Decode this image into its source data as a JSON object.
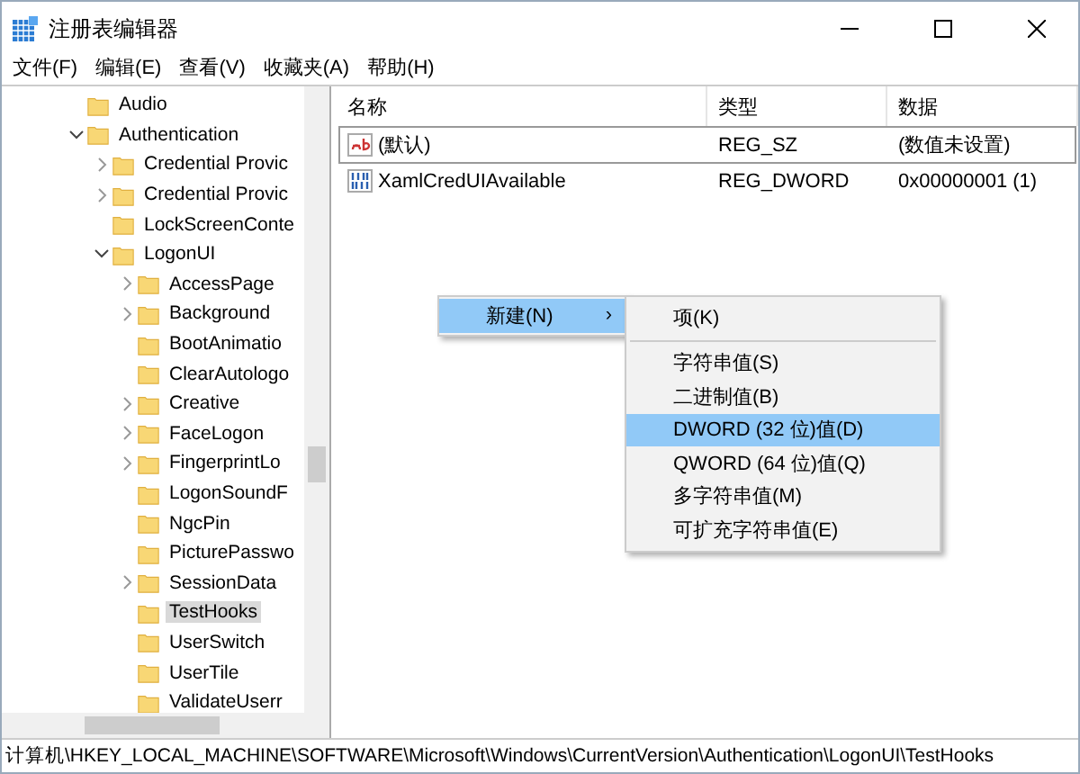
{
  "window": {
    "title": "注册表编辑器"
  },
  "menu": [
    "文件(F)",
    "编辑(E)",
    "查看(V)",
    "收藏夹(A)",
    "帮助(H)"
  ],
  "tree": [
    {
      "label": "Audio",
      "kind": "leaf",
      "selected": false
    },
    {
      "label": "Authentication",
      "kind": "open",
      "selected": false,
      "children": [
        {
          "label": "Credential Provic",
          "kind": "closed",
          "selected": false
        },
        {
          "label": "Credential Provic",
          "kind": "closed",
          "selected": false
        },
        {
          "label": "LockScreenConte",
          "kind": "leaf",
          "selected": false
        },
        {
          "label": "LogonUI",
          "kind": "open",
          "selected": false,
          "children": [
            {
              "label": "AccessPage",
              "kind": "closed",
              "selected": false
            },
            {
              "label": "Background",
              "kind": "closed",
              "selected": false
            },
            {
              "label": "BootAnimatio",
              "kind": "leaf",
              "selected": false
            },
            {
              "label": "ClearAutologo",
              "kind": "leaf",
              "selected": false
            },
            {
              "label": "Creative",
              "kind": "closed",
              "selected": false
            },
            {
              "label": "FaceLogon",
              "kind": "closed",
              "selected": false
            },
            {
              "label": "FingerprintLo",
              "kind": "closed",
              "selected": false
            },
            {
              "label": "LogonSoundF",
              "kind": "leaf",
              "selected": false
            },
            {
              "label": "NgcPin",
              "kind": "leaf",
              "selected": false
            },
            {
              "label": "PicturePasswo",
              "kind": "leaf",
              "selected": false
            },
            {
              "label": "SessionData",
              "kind": "closed",
              "selected": false
            },
            {
              "label": "TestHooks",
              "kind": "leaf",
              "selected": true
            },
            {
              "label": "UserSwitch",
              "kind": "leaf",
              "selected": false
            },
            {
              "label": "UserTile",
              "kind": "leaf",
              "selected": false
            },
            {
              "label": "ValidateUserr",
              "kind": "leaf",
              "selected": false
            }
          ]
        }
      ]
    }
  ],
  "table": {
    "columns": [
      "名称",
      "类型",
      "数据"
    ],
    "rows": [
      {
        "kind": "string",
        "name": "(默认)",
        "type": "REG_SZ",
        "data": "(数值未设置)",
        "selected": true
      },
      {
        "kind": "binary",
        "name": "XamlCredUIAvailable",
        "type": "REG_DWORD",
        "data": "0x00000001 (1)",
        "selected": false
      }
    ]
  },
  "context_menu": {
    "items": [
      {
        "label": "新建(N)",
        "arrow": "›",
        "selected": true
      }
    ]
  },
  "submenu": {
    "items": [
      {
        "label": "项(K)",
        "selected": false,
        "separator_after": true
      },
      {
        "label": "字符串值(S)",
        "selected": false,
        "separator_after": false
      },
      {
        "label": "二进制值(B)",
        "selected": false,
        "separator_after": false
      },
      {
        "label": "DWORD (32 位)值(D)",
        "selected": true,
        "separator_after": false
      },
      {
        "label": "QWORD (64 位)值(Q)",
        "selected": false,
        "separator_after": false
      },
      {
        "label": "多字符串值(M)",
        "selected": false,
        "separator_after": false
      },
      {
        "label": "可扩充字符串值(E)",
        "selected": false,
        "separator_after": false
      }
    ]
  },
  "status_bar": "计算机\\HKEY_LOCAL_MACHINE\\SOFTWARE\\Microsoft\\Windows\\CurrentVersion\\Authentication\\LogonUI\\TestHooks"
}
